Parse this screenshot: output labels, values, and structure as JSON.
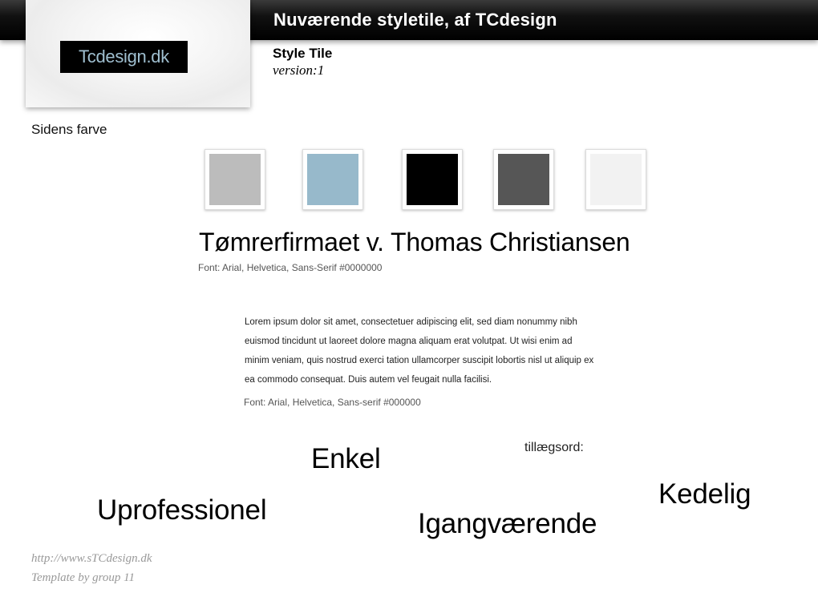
{
  "header": {
    "title": "Nuværende styletile, af TCdesign"
  },
  "logo": {
    "text": "Tcdesign.dk"
  },
  "tile": {
    "name": "Style Tile",
    "version": "version:1"
  },
  "colors": {
    "label": "Sidens farve",
    "swatches": [
      "#bcbcbc",
      "#97b9cb",
      "#000000",
      "#565656",
      "#f2f2f2"
    ]
  },
  "typography": {
    "heading_sample": "Tømrerfirmaet v. Thomas Christiansen",
    "heading_font_note": "Font: Arial, Helvetica, Sans-Serif  #0000000",
    "body_lines": [
      "Lorem ipsum dolor sit amet, consectetuer adipiscing elit, sed diam nonummy nibh",
      "euismod tincidunt ut laoreet dolore magna aliquam erat volutpat. Ut wisi enim ad",
      "minim veniam, quis nostrud exerci tation ullamcorper suscipit lobortis nisl ut aliquip ex",
      "ea commodo consequat. Duis autem vel feugait nulla facilisi."
    ],
    "body_font_note": "Font: Arial, Helvetica, Sans-serif  #000000"
  },
  "adjectives": {
    "label": "tillægsord:",
    "words": [
      "Enkel",
      "Kedelig",
      "Uprofessionel",
      "Igangværende"
    ]
  },
  "footer": {
    "url": "http://www.sTCdesign.dk",
    "credit": "Template by group 11"
  }
}
